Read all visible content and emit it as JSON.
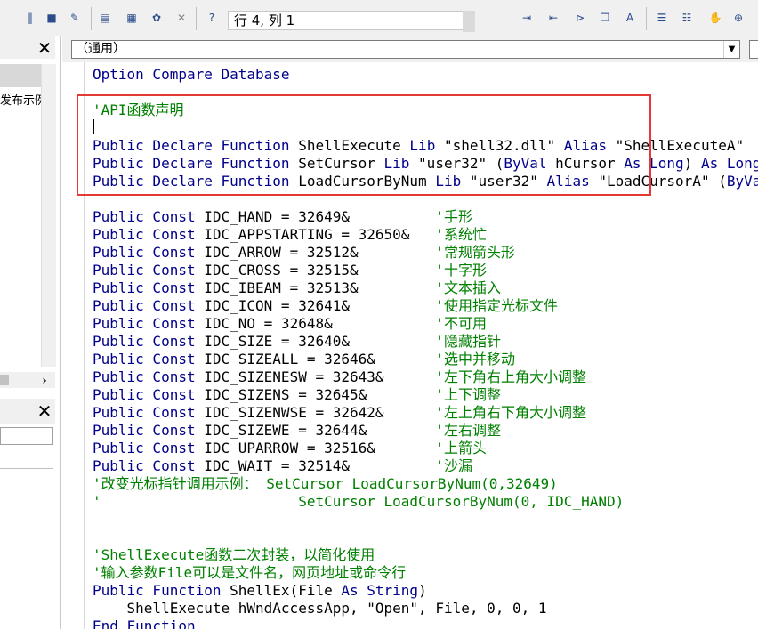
{
  "toolbar": {
    "status": "行 4, 列 1",
    "icons": [
      "pause-icon",
      "stop-icon",
      "design-mode-icon",
      "project-explorer-icon",
      "properties-icon",
      "object-browser-icon",
      "toolbox-icon",
      "help-icon",
      "indent-icon",
      "outdent-icon",
      "toggle-breakpoint-icon",
      "comment-block-icon",
      "uncomment-block-icon",
      "toggle-bookmark-icon",
      "next-bookmark-icon",
      "prev-bookmark-icon",
      "clear-bookmarks-icon"
    ]
  },
  "left_pane": {
    "tree_text": "发布示例"
  },
  "code_pane": {
    "object_combo": "（通用）",
    "lines": [
      [
        {
          "t": "Option Compare Database",
          "c": "kw"
        }
      ],
      [],
      [
        {
          "t": "'API函数声明",
          "c": "cm"
        }
      ],
      [],
      [
        {
          "t": "Public Declare Function ",
          "c": "kw"
        },
        {
          "t": "ShellExecute ",
          "c": "tx"
        },
        {
          "t": "Lib ",
          "c": "kw"
        },
        {
          "t": "\"shell32.dll\" ",
          "c": "tx"
        },
        {
          "t": "Alias ",
          "c": "kw"
        },
        {
          "t": "\"ShellExecuteA\"",
          "c": "tx"
        }
      ],
      [
        {
          "t": "Public Declare Function ",
          "c": "kw"
        },
        {
          "t": "SetCursor ",
          "c": "tx"
        },
        {
          "t": "Lib ",
          "c": "kw"
        },
        {
          "t": "\"user32\" (",
          "c": "tx"
        },
        {
          "t": "ByVal ",
          "c": "kw"
        },
        {
          "t": "hCursor ",
          "c": "tx"
        },
        {
          "t": "As Long",
          "c": "kw"
        },
        {
          "t": ") ",
          "c": "tx"
        },
        {
          "t": "As Long",
          "c": "kw"
        }
      ],
      [
        {
          "t": "Public Declare Function ",
          "c": "kw"
        },
        {
          "t": "LoadCursorByNum ",
          "c": "tx"
        },
        {
          "t": "Lib ",
          "c": "kw"
        },
        {
          "t": "\"user32\" ",
          "c": "tx"
        },
        {
          "t": "Alias ",
          "c": "kw"
        },
        {
          "t": "\"LoadCursorA\" (",
          "c": "tx"
        },
        {
          "t": "ByVal",
          "c": "kw"
        }
      ],
      [],
      [
        {
          "t": "Public Const ",
          "c": "kw"
        },
        {
          "t": "IDC_HAND = 32649&          ",
          "c": "tx"
        },
        {
          "t": "'手形",
          "c": "cm"
        }
      ],
      [
        {
          "t": "Public Const ",
          "c": "kw"
        },
        {
          "t": "IDC_APPSTARTING = 32650&   ",
          "c": "tx"
        },
        {
          "t": "'系统忙",
          "c": "cm"
        }
      ],
      [
        {
          "t": "Public Const ",
          "c": "kw"
        },
        {
          "t": "IDC_ARROW = 32512&         ",
          "c": "tx"
        },
        {
          "t": "'常规箭头形",
          "c": "cm"
        }
      ],
      [
        {
          "t": "Public Const ",
          "c": "kw"
        },
        {
          "t": "IDC_CROSS = 32515&         ",
          "c": "tx"
        },
        {
          "t": "'十字形",
          "c": "cm"
        }
      ],
      [
        {
          "t": "Public Const ",
          "c": "kw"
        },
        {
          "t": "IDC_IBEAM = 32513&         ",
          "c": "tx"
        },
        {
          "t": "'文本插入",
          "c": "cm"
        }
      ],
      [
        {
          "t": "Public Const ",
          "c": "kw"
        },
        {
          "t": "IDC_ICON = 32641&          ",
          "c": "tx"
        },
        {
          "t": "'使用指定光标文件",
          "c": "cm"
        }
      ],
      [
        {
          "t": "Public Const ",
          "c": "kw"
        },
        {
          "t": "IDC_NO = 32648&            ",
          "c": "tx"
        },
        {
          "t": "'不可用",
          "c": "cm"
        }
      ],
      [
        {
          "t": "Public Const ",
          "c": "kw"
        },
        {
          "t": "IDC_SIZE = 32640&          ",
          "c": "tx"
        },
        {
          "t": "'隐藏指针",
          "c": "cm"
        }
      ],
      [
        {
          "t": "Public Const ",
          "c": "kw"
        },
        {
          "t": "IDC_SIZEALL = 32646&       ",
          "c": "tx"
        },
        {
          "t": "'选中并移动",
          "c": "cm"
        }
      ],
      [
        {
          "t": "Public Const ",
          "c": "kw"
        },
        {
          "t": "IDC_SIZENESW = 32643&      ",
          "c": "tx"
        },
        {
          "t": "'左下角右上角大小调整",
          "c": "cm"
        }
      ],
      [
        {
          "t": "Public Const ",
          "c": "kw"
        },
        {
          "t": "IDC_SIZENS = 32645&        ",
          "c": "tx"
        },
        {
          "t": "'上下调整",
          "c": "cm"
        }
      ],
      [
        {
          "t": "Public Const ",
          "c": "kw"
        },
        {
          "t": "IDC_SIZENWSE = 32642&      ",
          "c": "tx"
        },
        {
          "t": "'左上角右下角大小调整",
          "c": "cm"
        }
      ],
      [
        {
          "t": "Public Const ",
          "c": "kw"
        },
        {
          "t": "IDC_SIZEWE = 32644&        ",
          "c": "tx"
        },
        {
          "t": "'左右调整",
          "c": "cm"
        }
      ],
      [
        {
          "t": "Public Const ",
          "c": "kw"
        },
        {
          "t": "IDC_UPARROW = 32516&       ",
          "c": "tx"
        },
        {
          "t": "'上箭头",
          "c": "cm"
        }
      ],
      [
        {
          "t": "Public Const ",
          "c": "kw"
        },
        {
          "t": "IDC_WAIT = 32514&          ",
          "c": "tx"
        },
        {
          "t": "'沙漏",
          "c": "cm"
        }
      ],
      [
        {
          "t": "'改变光标指针调用示例： SetCursor LoadCursorByNum(0,32649)",
          "c": "cm"
        }
      ],
      [
        {
          "t": "'                       SetCursor LoadCursorByNum(0, IDC_HAND)",
          "c": "cm"
        }
      ],
      [],
      [],
      [
        {
          "t": "'ShellExecute函数二次封装，以简化使用",
          "c": "cm"
        }
      ],
      [
        {
          "t": "'输入参数File可以是文件名，网页地址或命令行",
          "c": "cm"
        }
      ],
      [
        {
          "t": "Public Function ",
          "c": "kw"
        },
        {
          "t": "ShellEx(File ",
          "c": "tx"
        },
        {
          "t": "As String",
          "c": "kw"
        },
        {
          "t": ")",
          "c": "tx"
        }
      ],
      [
        {
          "t": "    ShellExecute hWndAccessApp, \"Open\", File, 0, 0, 1",
          "c": "tx"
        }
      ],
      [
        {
          "t": "End Function",
          "c": "kw"
        }
      ]
    ]
  }
}
